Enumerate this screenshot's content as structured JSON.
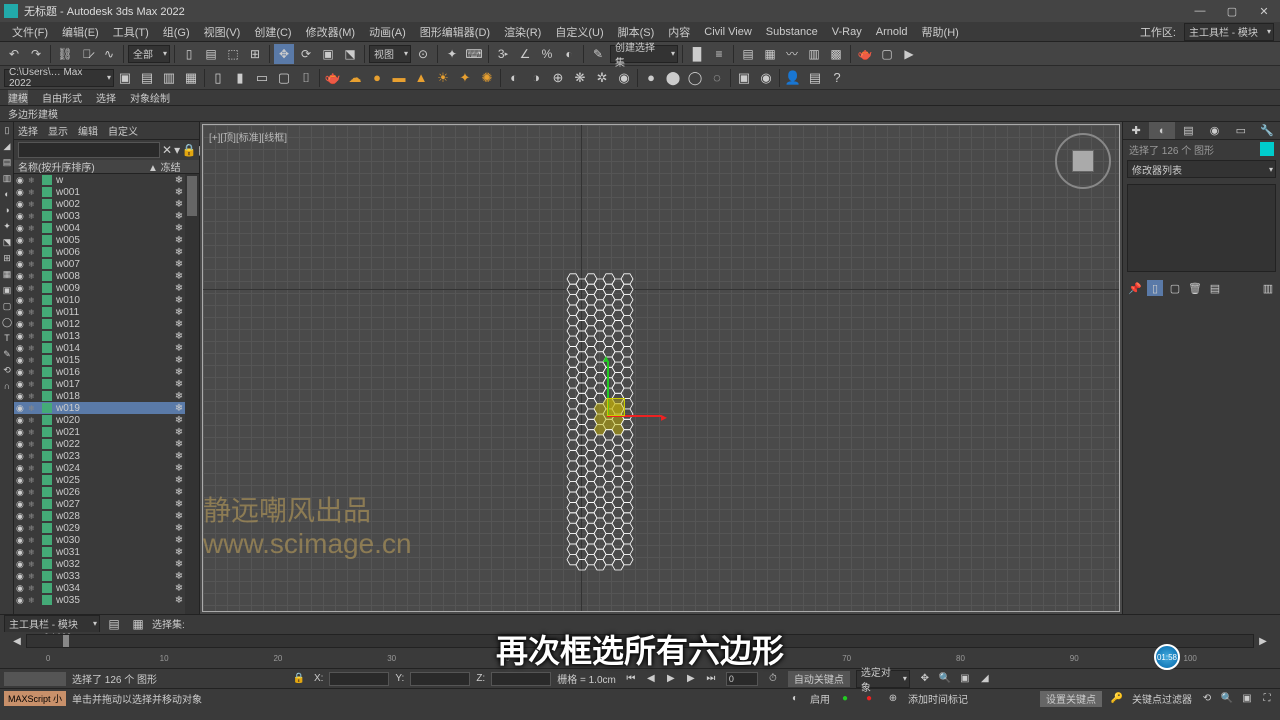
{
  "app": {
    "title": "无标题 - Autodesk 3ds Max 2022",
    "workspace_label": "工作区:",
    "workspace_value": "主工具栏 - 模块"
  },
  "menus": [
    "文件(F)",
    "编辑(E)",
    "工具(T)",
    "组(G)",
    "视图(V)",
    "创建(C)",
    "修改器(M)",
    "动画(A)",
    "图形编辑器(D)",
    "渲染(R)",
    "自定义(U)",
    "脚本(S)",
    "内容",
    "Civil View",
    "Substance",
    "V-Ray",
    "Arnold",
    "帮助(H)"
  ],
  "toolbar": {
    "filter": "全部",
    "view_label": "视图",
    "snap_set": "创建选择集"
  },
  "ribbon": {
    "path": "C:\\Users\\… Max 2022"
  },
  "ribbon_tabs": [
    "建模",
    "自由形式",
    "选择",
    "对象绘制"
  ],
  "poly_tab": "多边形建模",
  "scene": {
    "menu": [
      "选择",
      "显示",
      "编辑",
      "自定义"
    ],
    "cols": {
      "name": "名称(按升序排序)",
      "freeze": "▲ 冻结"
    },
    "items": [
      "w",
      "w001",
      "w002",
      "w003",
      "w004",
      "w005",
      "w006",
      "w007",
      "w008",
      "w009",
      "w010",
      "w011",
      "w012",
      "w013",
      "w014",
      "w015",
      "w016",
      "w017",
      "w018",
      "w019",
      "w020",
      "w021",
      "w022",
      "w023",
      "w024",
      "w025",
      "w026",
      "w027",
      "w028",
      "w029",
      "w030",
      "w031",
      "w032",
      "w033",
      "w034",
      "w035"
    ],
    "selected": "w019"
  },
  "viewport": {
    "label": "[+][顶][标准][线框]"
  },
  "watermark": {
    "l1": "静远嘲风出品",
    "l2": "www.scimage.cn"
  },
  "right": {
    "sel_info": "选择了 126 个 图形",
    "modlist": "修改器列表"
  },
  "timeline": {
    "frame": "0 / 100",
    "knob": "01:58"
  },
  "bottom1": {
    "toolbar_label": "主工具栏 - 模块",
    "selset": "选择集:"
  },
  "status": {
    "sel": "选择了 126 个 图形",
    "x": "X:",
    "y": "Y:",
    "z": "Z:",
    "grid": "栅格 = 1.0cm",
    "autokey": "自动关键点",
    "seldef": "选定对象",
    "setkey": "设置关键点",
    "keyfilter": "关键点过滤器",
    "scriptplay_label": "启用",
    "addtime": "添加时间标记"
  },
  "maxscript": {
    "label": "MAXScript 小",
    "hint": "单击并拖动以选择并移动对象"
  },
  "subtitle": "再次框选所有六边形"
}
